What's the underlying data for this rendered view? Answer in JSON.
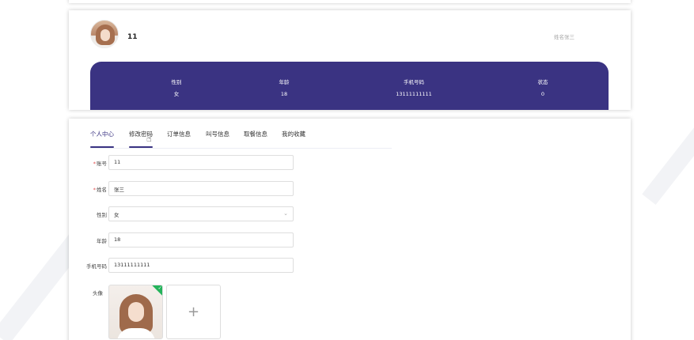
{
  "profile": {
    "username": "11",
    "real_name_text": "姓名张三",
    "stats": [
      {
        "label": "性别",
        "value": "女"
      },
      {
        "label": "年龄",
        "value": "18"
      },
      {
        "label": "手机号码",
        "value": "13111111111"
      },
      {
        "label": "状态",
        "value": "0"
      }
    ]
  },
  "tabs": [
    {
      "label": "个人中心",
      "active": true
    },
    {
      "label": "修改密码",
      "active": false
    },
    {
      "label": "订单信息",
      "active": false
    },
    {
      "label": "叫号信息",
      "active": false
    },
    {
      "label": "取餐信息",
      "active": false
    },
    {
      "label": "我的收藏",
      "active": false
    }
  ],
  "form": {
    "required_mark": "*",
    "account": {
      "label": "账号",
      "value": "11"
    },
    "name": {
      "label": "姓名",
      "value": "张三"
    },
    "gender": {
      "label": "性别",
      "value": "女",
      "options": [
        "女"
      ]
    },
    "age": {
      "label": "年龄",
      "value": "18"
    },
    "phone": {
      "label": "手机号码",
      "value": "13111111111"
    },
    "avatar": {
      "label": "头像",
      "add_symbol": "+"
    }
  },
  "colors": {
    "accent": "#3a3382",
    "success": "#24b35b"
  },
  "icons": {
    "select_chevron": "chevron-down-icon",
    "upload_success": "check-icon",
    "upload_add": "plus-icon"
  }
}
